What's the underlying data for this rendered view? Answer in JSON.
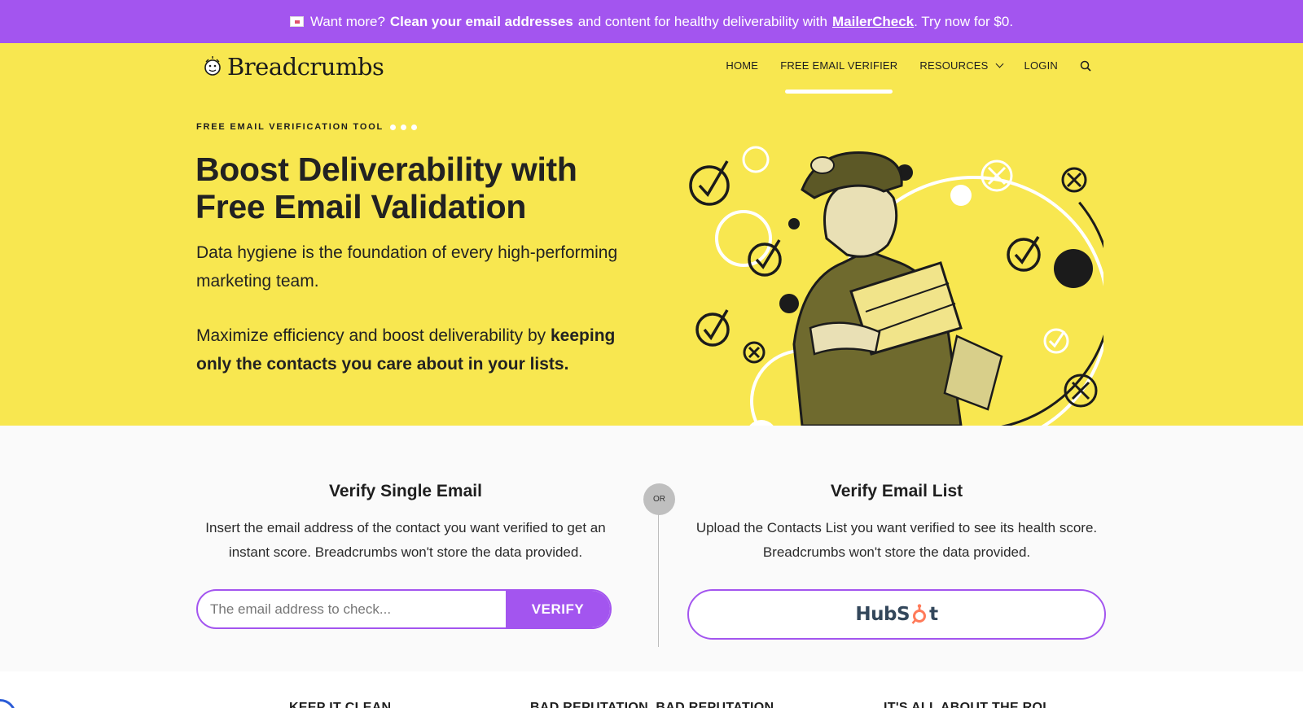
{
  "promo": {
    "text1": "Want more?",
    "bold1": "Clean your email addresses",
    "text2": "and content for healthy deliverability with",
    "link": "MailerCheck",
    "text3": ". Try now for $0.",
    "icon": "envelope-icon"
  },
  "header": {
    "logo_text": "Breadcrumbs",
    "nav": [
      {
        "label": "HOME"
      },
      {
        "label": "FREE EMAIL VERIFIER"
      },
      {
        "label": "RESOURCES"
      },
      {
        "label": "LOGIN"
      }
    ]
  },
  "hero": {
    "eyebrow": "FREE EMAIL VERIFICATION TOOL",
    "headline": "Boost Deliverability with Free Email Validation",
    "lead": "Data hygiene is the foundation of every high-performing marketing team.",
    "lead2_plain": "Maximize efficiency and boost deliverability by",
    "lead2_bold": "keeping only the contacts you care about in your lists."
  },
  "single": {
    "title": "Verify Single Email",
    "description": "Insert the email address of the contact you want verified to get an instant score. Breadcrumbs won't store the data provided.",
    "placeholder": "The email address to check...",
    "button": "VERIFY"
  },
  "or_label": "OR",
  "list": {
    "title": "Verify Email List",
    "description": "Upload the Contacts List you want verified to see its health score. Breadcrumbs won't store the data provided.",
    "hubspot_pre": "HubS",
    "hubspot_post": "t"
  },
  "lower": {
    "titles": [
      "KEEP IT CLEAN",
      "BAD REPUTATION, BAD REPUTATION",
      "IT'S ALL ABOUT THE ROI"
    ]
  },
  "colors": {
    "accent": "#a355ef",
    "hero_bg": "#f8e750",
    "hubspot_orange": "#ff7a59"
  }
}
